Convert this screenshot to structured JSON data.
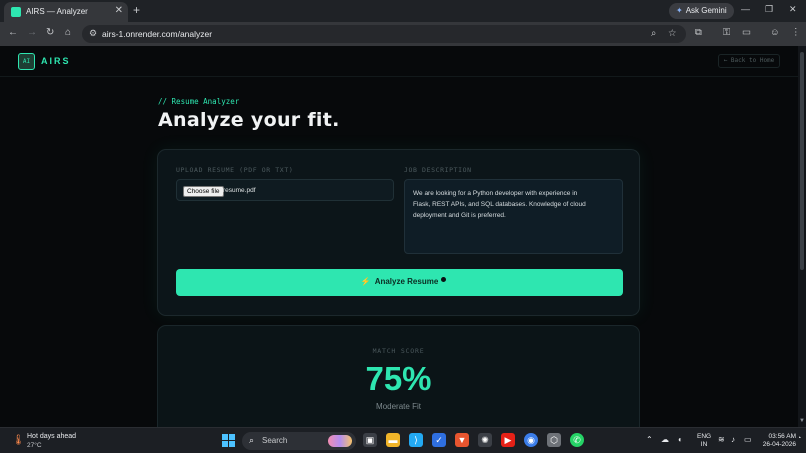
{
  "browser": {
    "tab_title": "AIRS — Analyzer",
    "tab_close": "✕",
    "new_tab": "+",
    "gemini_label": "Ask Gemini",
    "url": "airs-1.onrender.com/analyzer",
    "window_controls": [
      "—",
      "❐",
      "✕"
    ]
  },
  "site": {
    "logo_mark": "AI",
    "logo_text": "AIRS",
    "back_link": "← Back to Home"
  },
  "hero": {
    "eyebrow": "// Resume Analyzer",
    "headline": "Analyze your fit."
  },
  "form": {
    "upload_label": "UPLOAD RESUME (PDF OR TXT)",
    "choose_file_label": "Choose file",
    "file_name": "resume.pdf",
    "jd_label": "JOB DESCRIPTION",
    "jd_value": "We are looking for a Python developer with experience in\nFlask, REST APIs, and SQL databases. Knowledge of cloud\ndeployment and Git is preferred.",
    "analyze_label": "Analyze Resume",
    "analyze_icon": "⚡"
  },
  "result": {
    "label": "MATCH SCORE",
    "score": "75%",
    "verdict": "Moderate Fit"
  },
  "taskbar": {
    "weather_title": "Hot days ahead",
    "weather_temp": "27°C",
    "search_label": "Search",
    "lang_top": "ENG",
    "lang_bottom": "IN",
    "time": "03:56 AM",
    "date": "26-04-2026"
  },
  "colors": {
    "accent": "#2ee6b0",
    "page_bg": "#07090b",
    "card_bg": "#0c1519"
  }
}
